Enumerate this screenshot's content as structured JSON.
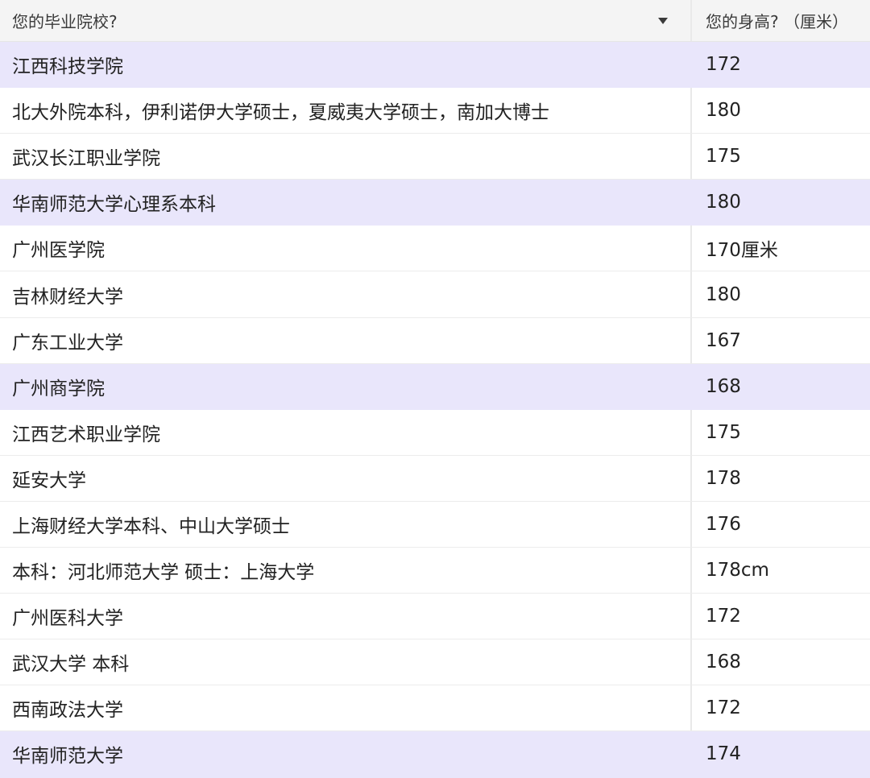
{
  "table": {
    "header": {
      "school_label": "您的毕业院校?",
      "height_label": "您的身高? （厘米）",
      "sort_icon": "caret-down-icon"
    },
    "highlight_color": "#e9e6fb",
    "rows": [
      {
        "school": "江西科技学院",
        "height": "172",
        "highlighted": true
      },
      {
        "school": "北大外院本科，伊利诺伊大学硕士，夏威夷大学硕士，南加大博士",
        "height": "180",
        "highlighted": false
      },
      {
        "school": "武汉长江职业学院",
        "height": "175",
        "highlighted": false
      },
      {
        "school": "华南师范大学心理系本科",
        "height": "180",
        "highlighted": true
      },
      {
        "school": "广州医学院",
        "height": "170厘米",
        "highlighted": false
      },
      {
        "school": "吉林财经大学",
        "height": "180",
        "highlighted": false
      },
      {
        "school": "广东工业大学",
        "height": "167",
        "highlighted": false
      },
      {
        "school": "广州商学院",
        "height": "168",
        "highlighted": true
      },
      {
        "school": "江西艺术职业学院",
        "height": "175",
        "highlighted": false
      },
      {
        "school": "延安大学",
        "height": "178",
        "highlighted": false
      },
      {
        "school": "上海财经大学本科、中山大学硕士",
        "height": "176",
        "highlighted": false
      },
      {
        "school": "本科：河北师范大学 硕士：上海大学",
        "height": "178cm",
        "highlighted": false
      },
      {
        "school": "广州医科大学",
        "height": "172",
        "highlighted": false
      },
      {
        "school": "武汉大学 本科",
        "height": "168",
        "highlighted": false
      },
      {
        "school": "西南政法大学",
        "height": "172",
        "highlighted": false
      },
      {
        "school": "华南师范大学",
        "height": "174",
        "highlighted": true
      }
    ]
  }
}
